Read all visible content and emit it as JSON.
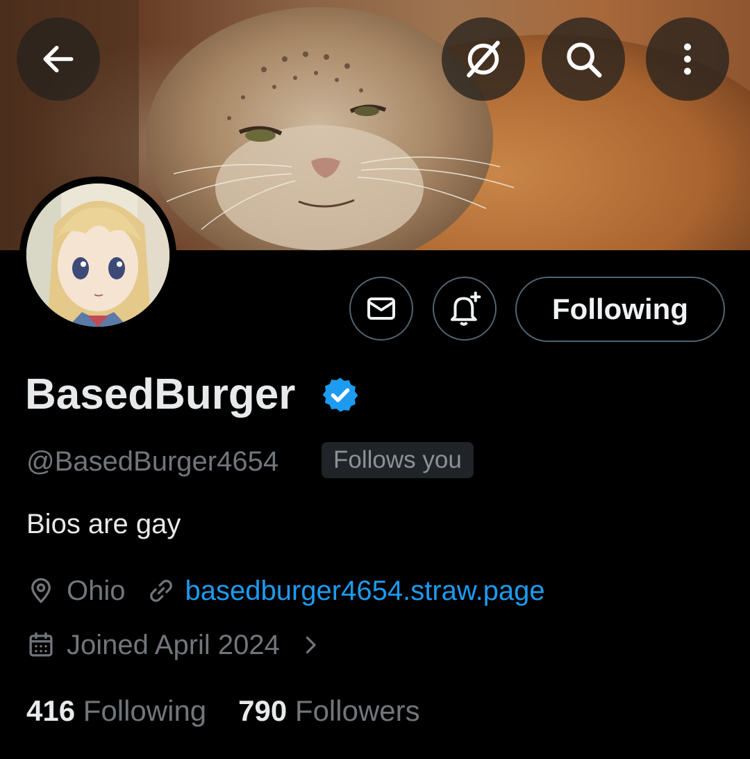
{
  "header": {
    "back_icon": "arrow-left-icon",
    "grok_icon": "grok-icon",
    "search_icon": "search-icon",
    "more_icon": "more-vertical-icon"
  },
  "profile": {
    "display_name": "BasedBurger",
    "verified": true,
    "handle": "@BasedBurger4654",
    "follows_you": "Follows you",
    "bio": "Bios are gay",
    "location": "Ohio",
    "website": "basedburger4654.straw.page",
    "joined": "Joined April 2024"
  },
  "actions": {
    "message_icon": "mail-icon",
    "notify_icon": "bell-plus-icon",
    "follow_label": "Following"
  },
  "stats": {
    "following_count": "416",
    "following_label": "Following",
    "followers_count": "790",
    "followers_label": "Followers"
  },
  "colors": {
    "background": "#000000",
    "text_primary": "#e7e9ea",
    "text_secondary": "#71767b",
    "link": "#1d9bf0",
    "verified_badge": "#1d9bf0",
    "border": "#536471"
  }
}
